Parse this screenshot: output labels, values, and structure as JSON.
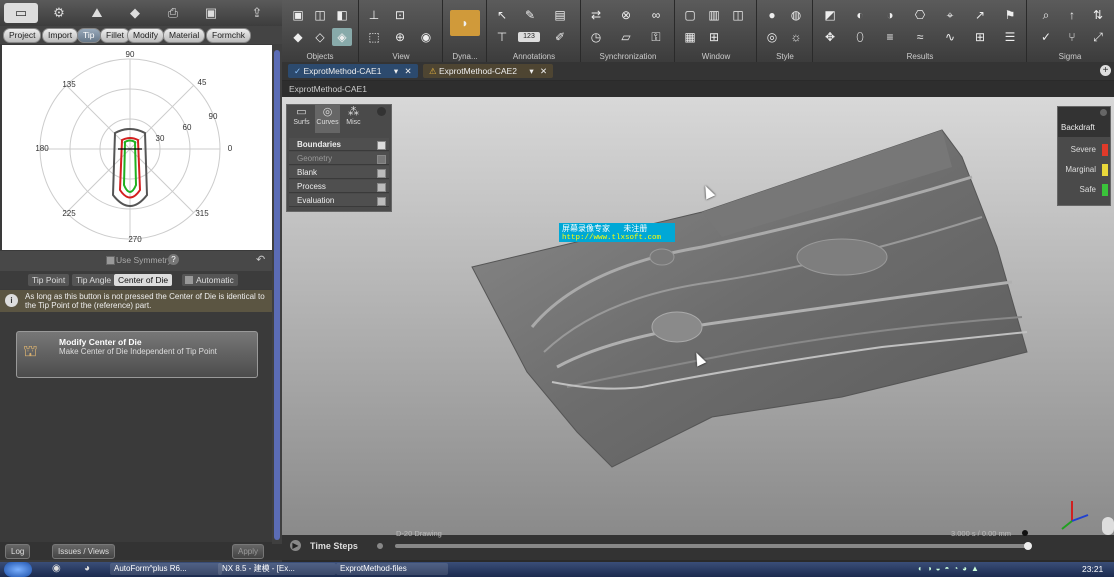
{
  "left_panel": {
    "stage_tabs": [
      "Project",
      "Import",
      "Tip",
      "Fillet",
      "Modify",
      "Material",
      "Formchk"
    ],
    "active_stage": "Tip",
    "polar": {
      "angles": [
        "90",
        "45",
        "0",
        "315",
        "270",
        "225",
        "180",
        "135"
      ],
      "radii": [
        "30",
        "60",
        "90"
      ]
    },
    "use_symmetry": "Use Symmetry",
    "sub_tabs": [
      "Tip Point",
      "Tip Angle",
      "Center of Die"
    ],
    "automatic": "Automatic",
    "info_text": "As long as this button is not pressed the Center of Die is identical to the Tip Point of the (reference) part.",
    "modify_title": "Modify Center of Die",
    "modify_desc": "Make Center of Die Independent of Tip Point",
    "log": "Log",
    "issues": "Issues / Views",
    "apply": "Apply"
  },
  "ribbon": {
    "groups": [
      "Objects",
      "View",
      "Dyna...",
      "Annotations",
      "Synchronization",
      "Window",
      "Style",
      "Results",
      "Sigma"
    ],
    "annotation_value": "123"
  },
  "doc_tabs": [
    {
      "label": "ExprotMethod-CAE1",
      "icon": "check-icon"
    },
    {
      "label": "ExprotMethod-CAE2",
      "icon": "warning-icon"
    }
  ],
  "view_title": "ExprotMethod-CAE1",
  "control_panel": {
    "tabs": [
      "Surfs",
      "Curves",
      "Misc"
    ],
    "rows": [
      "Boundaries",
      "Geometry",
      "Blank",
      "Process",
      "Evaluation"
    ]
  },
  "legend": {
    "title": "Backdraft",
    "items": [
      {
        "label": "Severe",
        "color": "#e03a2a"
      },
      {
        "label": "Marginal",
        "color": "#e8d83a"
      },
      {
        "label": "Safe",
        "color": "#3ac43a"
      }
    ]
  },
  "cn_watermark": {
    "line1": "屏幕录像专家      未注册",
    "line2": "http://www.tlxsoft.com"
  },
  "time_steps": {
    "label": "Time Steps",
    "stage": "D-20 Drawing",
    "readout": "3.000 s / 0.00 mm"
  },
  "taskbar": {
    "items": [
      "AutoForm^plus R6...",
      "NX 8.5 - 建模 - [Ex...",
      "ExprotMethod-files"
    ],
    "clock": "23:21"
  }
}
